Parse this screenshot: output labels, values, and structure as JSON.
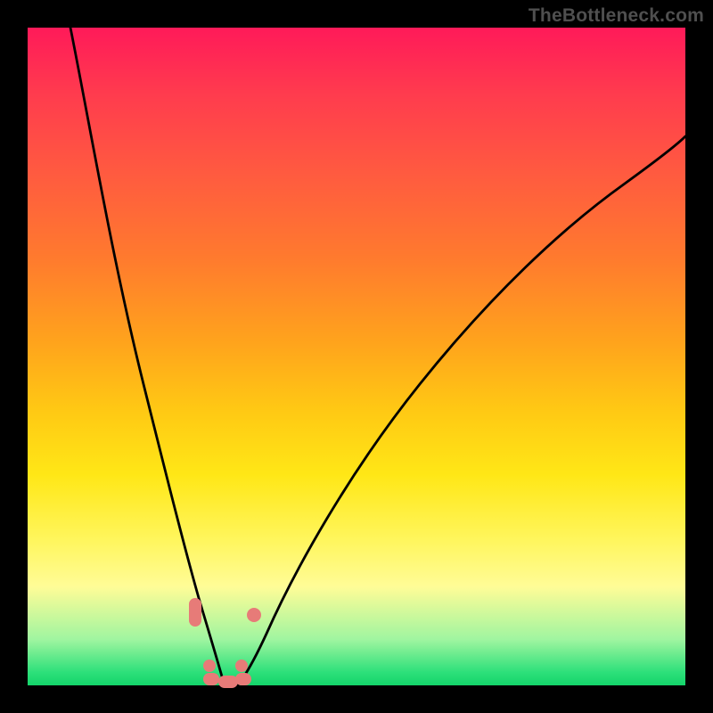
{
  "watermark": "TheBottleneck.com",
  "chart_data": {
    "type": "line",
    "title": "",
    "xlabel": "",
    "ylabel": "",
    "xlim": [
      0,
      1
    ],
    "ylim": [
      0,
      1
    ],
    "series": [
      {
        "name": "curve-left",
        "x": [
          0.065,
          0.09,
          0.11,
          0.13,
          0.15,
          0.17,
          0.19,
          0.21,
          0.225,
          0.24,
          0.255,
          0.267,
          0.277,
          0.287,
          0.295,
          0.303
        ],
        "y": [
          0.0,
          0.12,
          0.22,
          0.32,
          0.42,
          0.52,
          0.61,
          0.7,
          0.77,
          0.83,
          0.875,
          0.912,
          0.945,
          0.975,
          0.998,
          1.01
        ]
      },
      {
        "name": "curve-right",
        "x": [
          0.303,
          0.32,
          0.34,
          0.365,
          0.4,
          0.45,
          0.51,
          0.58,
          0.66,
          0.74,
          0.82,
          0.9,
          0.97,
          1.0
        ],
        "y": [
          1.01,
          1.0,
          0.972,
          0.93,
          0.86,
          0.77,
          0.67,
          0.565,
          0.46,
          0.37,
          0.29,
          0.22,
          0.16,
          0.135
        ]
      }
    ],
    "near_bottom_markers": {
      "left_pair": {
        "x": 0.253,
        "y1": 0.875,
        "y2": 0.908
      },
      "right_dot": {
        "x": 0.34,
        "y": 0.895
      },
      "floor_row": [
        [
          0.275,
          0.998
        ],
        [
          0.3,
          1.0
        ],
        [
          0.325,
          1.0
        ],
        [
          0.282,
          0.985
        ],
        [
          0.316,
          0.985
        ]
      ]
    }
  }
}
